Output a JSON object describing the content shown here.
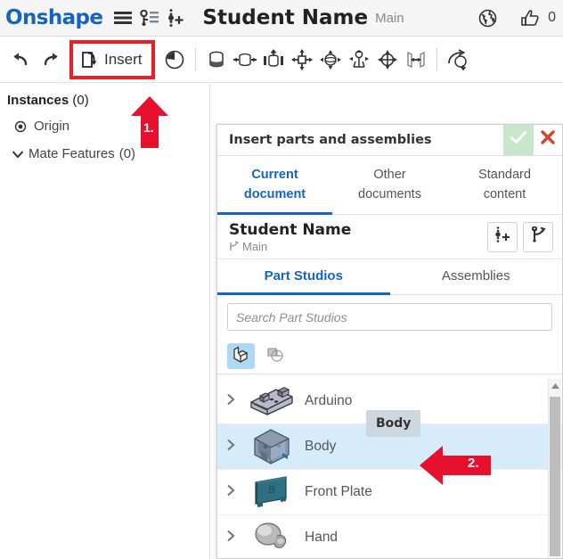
{
  "appbar": {
    "logo": "Onshape",
    "menu_icon": "hamburger-menu-icon",
    "versions_icon": "version-graph-icon",
    "add_instance_icon": "add-instance-icon",
    "document_title": "Student Name",
    "branch": "Main",
    "globe_icon": "globe-icon",
    "like_icon": "thumbs-up-icon",
    "like_count": "0"
  },
  "toolbar": {
    "undo_icon": "undo-icon",
    "redo_icon": "redo-icon",
    "insert_label": "Insert",
    "insert_icon": "insert-part-icon",
    "history_icon": "history-clock-icon",
    "icons": [
      "fastened-mate-icon",
      "revolute-mate-icon",
      "slider-mate-icon",
      "planar-mate-icon",
      "ball-mate-icon",
      "pin-slot-mate-icon",
      "cylindrical-mate-icon",
      "parallel-mate-icon",
      "mate-connector-icon"
    ]
  },
  "left_panel": {
    "instances_label": "Instances",
    "instances_count": "(0)",
    "origin_label": "Origin",
    "origin_icon": "origin-point-icon",
    "mate_features_label": "Mate Features",
    "mate_features_count": "(0)",
    "mate_caret_icon": "chevron-down-icon"
  },
  "annotations": [
    {
      "name": "step-1-arrow",
      "number": "1.",
      "direction": "up",
      "color": "#e8112d"
    },
    {
      "name": "step-2-arrow",
      "number": "2.",
      "direction": "left",
      "color": "#e8112d"
    }
  ],
  "dialog": {
    "title": "Insert parts and assemblies",
    "ok_icon": "checkmark-icon",
    "cancel_icon": "close-x-icon",
    "ok_color": "#c8e6c9",
    "cancel_color": "#d4452a",
    "accent_color": "#1565c0",
    "tabs": [
      {
        "line1": "Current",
        "line2": "document",
        "active": true
      },
      {
        "line1": "Other",
        "line2": "documents",
        "active": false
      },
      {
        "line1": "Standard",
        "line2": "content",
        "active": false
      }
    ],
    "document_name": "Student Name",
    "document_branch": "Main",
    "branch_icon": "branch-icon",
    "doc_buttons": [
      {
        "name": "add-instance-button",
        "icon": "add-instance-icon"
      },
      {
        "name": "branch-button",
        "icon": "branch-icon"
      }
    ],
    "subtabs": [
      {
        "label": "Part Studios",
        "active": true
      },
      {
        "label": "Assemblies",
        "active": false
      }
    ],
    "search_placeholder": "Search Part Studios",
    "search_value": "",
    "filters": [
      {
        "name": "parts-filter-button",
        "icon": "part-solid-icon",
        "active": true
      },
      {
        "name": "composite-parts-filter-button",
        "icon": "composite-part-icon",
        "active": false
      }
    ],
    "tooltip": "Body",
    "parts": [
      {
        "name": "Arduino",
        "selected": false,
        "caret": "chevron-right-icon",
        "thumb": "arduino-board-thumbnail"
      },
      {
        "name": "Body",
        "selected": true,
        "caret": "chevron-right-icon",
        "thumb": "body-part-thumbnail"
      },
      {
        "name": "Front Plate",
        "selected": false,
        "caret": "chevron-right-icon",
        "thumb": "front-plate-thumbnail"
      },
      {
        "name": "Hand",
        "selected": false,
        "caret": "chevron-right-icon",
        "thumb": "hand-part-thumbnail"
      }
    ],
    "scrollbar": {
      "up_icon": "scroll-up-arrow-icon"
    }
  }
}
